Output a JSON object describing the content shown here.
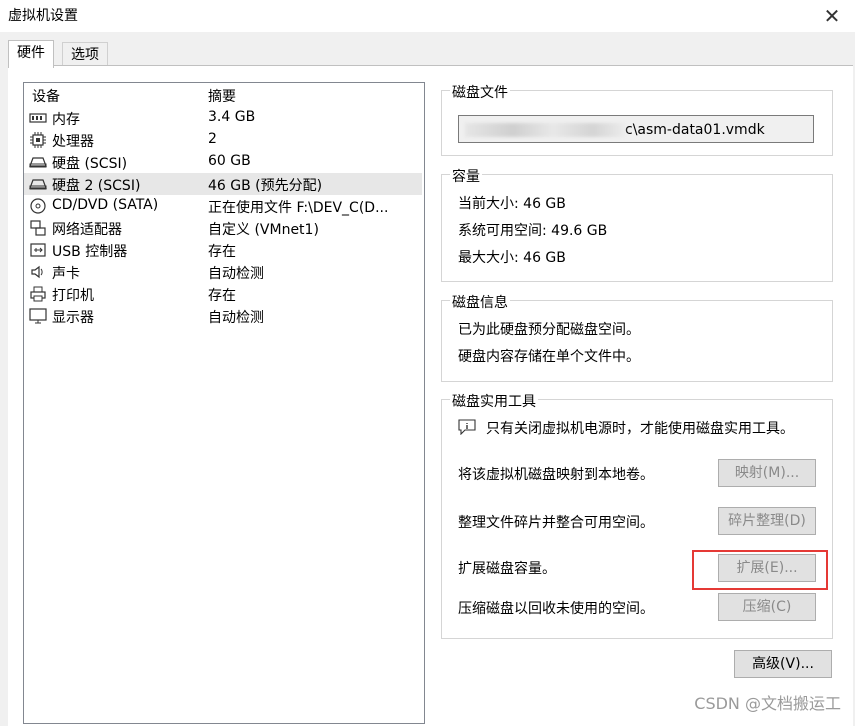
{
  "window": {
    "title": "虚拟机设置",
    "close_glyph": "✕"
  },
  "tabs": [
    {
      "label": "硬件",
      "active": true
    },
    {
      "label": "选项",
      "active": false
    }
  ],
  "device_list": {
    "columns": {
      "device": "设备",
      "summary": "摘要"
    },
    "rows": [
      {
        "icon": "memory-icon",
        "name": "内存",
        "summary": "3.4 GB",
        "selected": false
      },
      {
        "icon": "cpu-icon",
        "name": "处理器",
        "summary": "2",
        "selected": false
      },
      {
        "icon": "harddisk-icon",
        "name": "硬盘 (SCSI)",
        "summary": "60 GB",
        "selected": false
      },
      {
        "icon": "harddisk-icon",
        "name": "硬盘 2 (SCSI)",
        "summary": "46 GB (预先分配)",
        "selected": true
      },
      {
        "icon": "cd-dvd-icon",
        "name": "CD/DVD (SATA)",
        "summary": "正在使用文件 F:\\DEV_C(D...",
        "selected": false
      },
      {
        "icon": "network-adapter-icon",
        "name": "网络适配器",
        "summary": "自定义 (VMnet1)",
        "selected": false
      },
      {
        "icon": "usb-icon",
        "name": "USB 控制器",
        "summary": "存在",
        "selected": false
      },
      {
        "icon": "speaker-icon",
        "name": "声卡",
        "summary": "自动检测",
        "selected": false
      },
      {
        "icon": "printer-icon",
        "name": "打印机",
        "summary": "存在",
        "selected": false
      },
      {
        "icon": "monitor-icon",
        "name": "显示器",
        "summary": "自动检测",
        "selected": false
      }
    ]
  },
  "disk_file": {
    "title": "磁盘文件",
    "value_suffix": "c\\asm-data01.vmdk"
  },
  "capacity": {
    "title": "容量",
    "current_size": "当前大小: 46 GB",
    "system_free": "系统可用空间: 49.6 GB",
    "max_size": "最大大小: 46 GB"
  },
  "disk_info": {
    "title": "磁盘信息",
    "line1": "已为此硬盘预分配磁盘空间。",
    "line2": "硬盘内容存储在单个文件中。"
  },
  "disk_utils": {
    "title": "磁盘实用工具",
    "notice": "只有关闭虚拟机电源时，才能使用磁盘实用工具。",
    "map_desc": "将该虚拟机磁盘映射到本地卷。",
    "map_btn": "映射(M)...",
    "defrag_desc": "整理文件碎片并整合可用空间。",
    "defrag_btn": "碎片整理(D)",
    "expand_desc": "扩展磁盘容量。",
    "expand_btn": "扩展(E)...",
    "compact_desc": "压缩磁盘以回收未使用的空间。",
    "compact_btn": "压缩(C)"
  },
  "advanced_btn": "高级(V)...",
  "watermark": "CSDN @文档搬运工",
  "colors": {
    "highlight": "#e53935",
    "list_border": "#828790",
    "selected_row": "#e7e7e7"
  }
}
